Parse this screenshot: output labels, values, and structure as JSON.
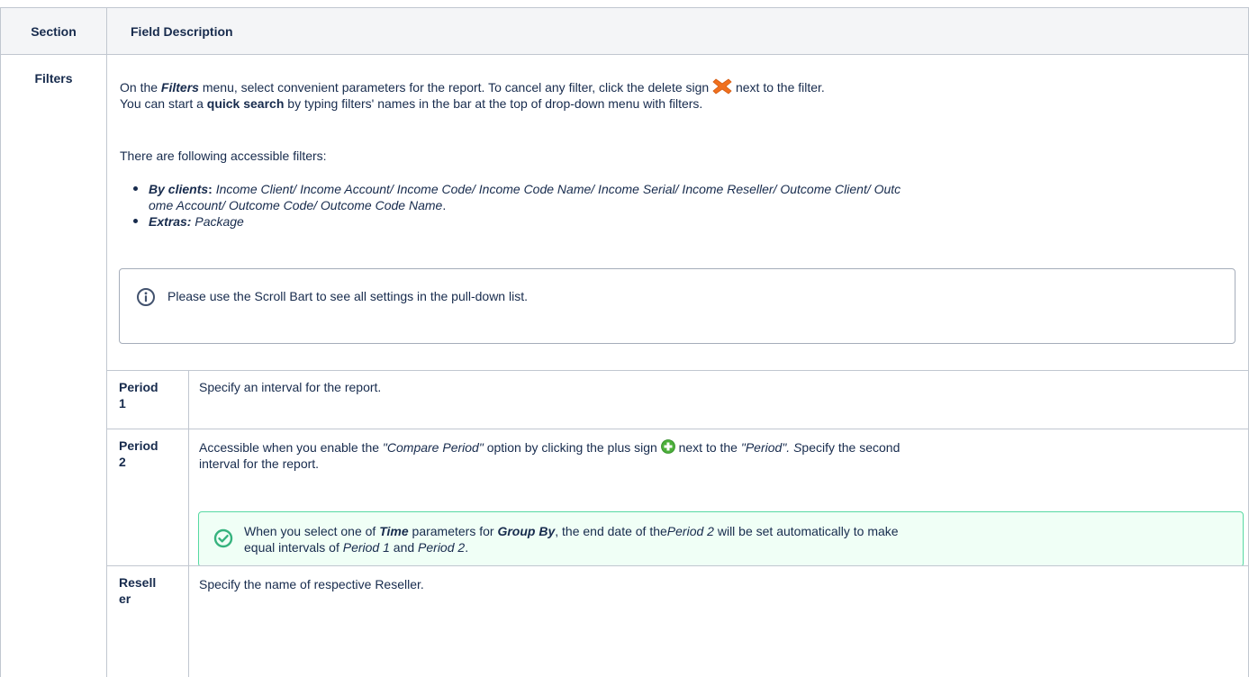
{
  "table": {
    "header": {
      "section": "Section",
      "field_description": "Field Description"
    },
    "filters": {
      "label": "Filters",
      "intro_1": "On the",
      "intro_filters": "Filters",
      "intro_2": "menu, select convenient parameters for the report. To cancel any filter, click the delete sign",
      "intro_3": "next to the filter.",
      "quick_1": "You can start a",
      "quick_bold": "quick search",
      "quick_2": "by typing filters' names in the bar at the top of drop-down menu with filters.",
      "accessible": "There are following accessible filters:",
      "items": [
        {
          "name": "By clients",
          "sep": ":",
          "text_line1": "Income Client/ Income Account/ Income Code/ Income Code Name/ Income Serial/ Income Reseller/ Outcome Client/ Outc",
          "text_line2": "ome Account/ Outcome Code/ Outcome Code Name",
          "end": "."
        },
        {
          "name": "Extras:",
          "text": "Package"
        }
      ],
      "info_note": "Please use the Scroll Bart to see all settings in the pull-down list."
    },
    "rows": [
      {
        "label_line1": "Period",
        "label_line2": "1",
        "description": "Specify an interval for the report."
      },
      {
        "label_line1": "Period",
        "label_line2": "2",
        "desc_1": "Accessible when you enable the",
        "desc_compare": "\"Compare Period\"",
        "desc_2": "option by clicking the plus sign",
        "desc_3": "next to the",
        "desc_period": "\"Period\". S",
        "desc_4": "pecify the second",
        "desc_line2": "interval for the report.",
        "note": {
          "a": "When you select one of",
          "time": "Time",
          "b": "parameters for",
          "groupby": "Group By",
          "c": ", the end date of the",
          "p2": "Period 2",
          "d": "will be set automatically to make",
          "e": "equal intervals of",
          "p1": "Period 1",
          "f": "and",
          "p2b": "Period 2",
          "g": "."
        }
      },
      {
        "label_line1": "Resell",
        "label_line2": "er",
        "description": "Specify the name of respective Reseller."
      }
    ]
  },
  "colors": {
    "header_bg": "#f4f5f7",
    "border": "#c1c7d0",
    "delete_icon": "#f0701e",
    "plus_icon": "#4caf3a",
    "success": "#36b37e"
  },
  "icons": {
    "delete": "delete-x-icon",
    "plus": "plus-circle-icon",
    "info": "info-icon",
    "success": "check-circle-icon"
  }
}
